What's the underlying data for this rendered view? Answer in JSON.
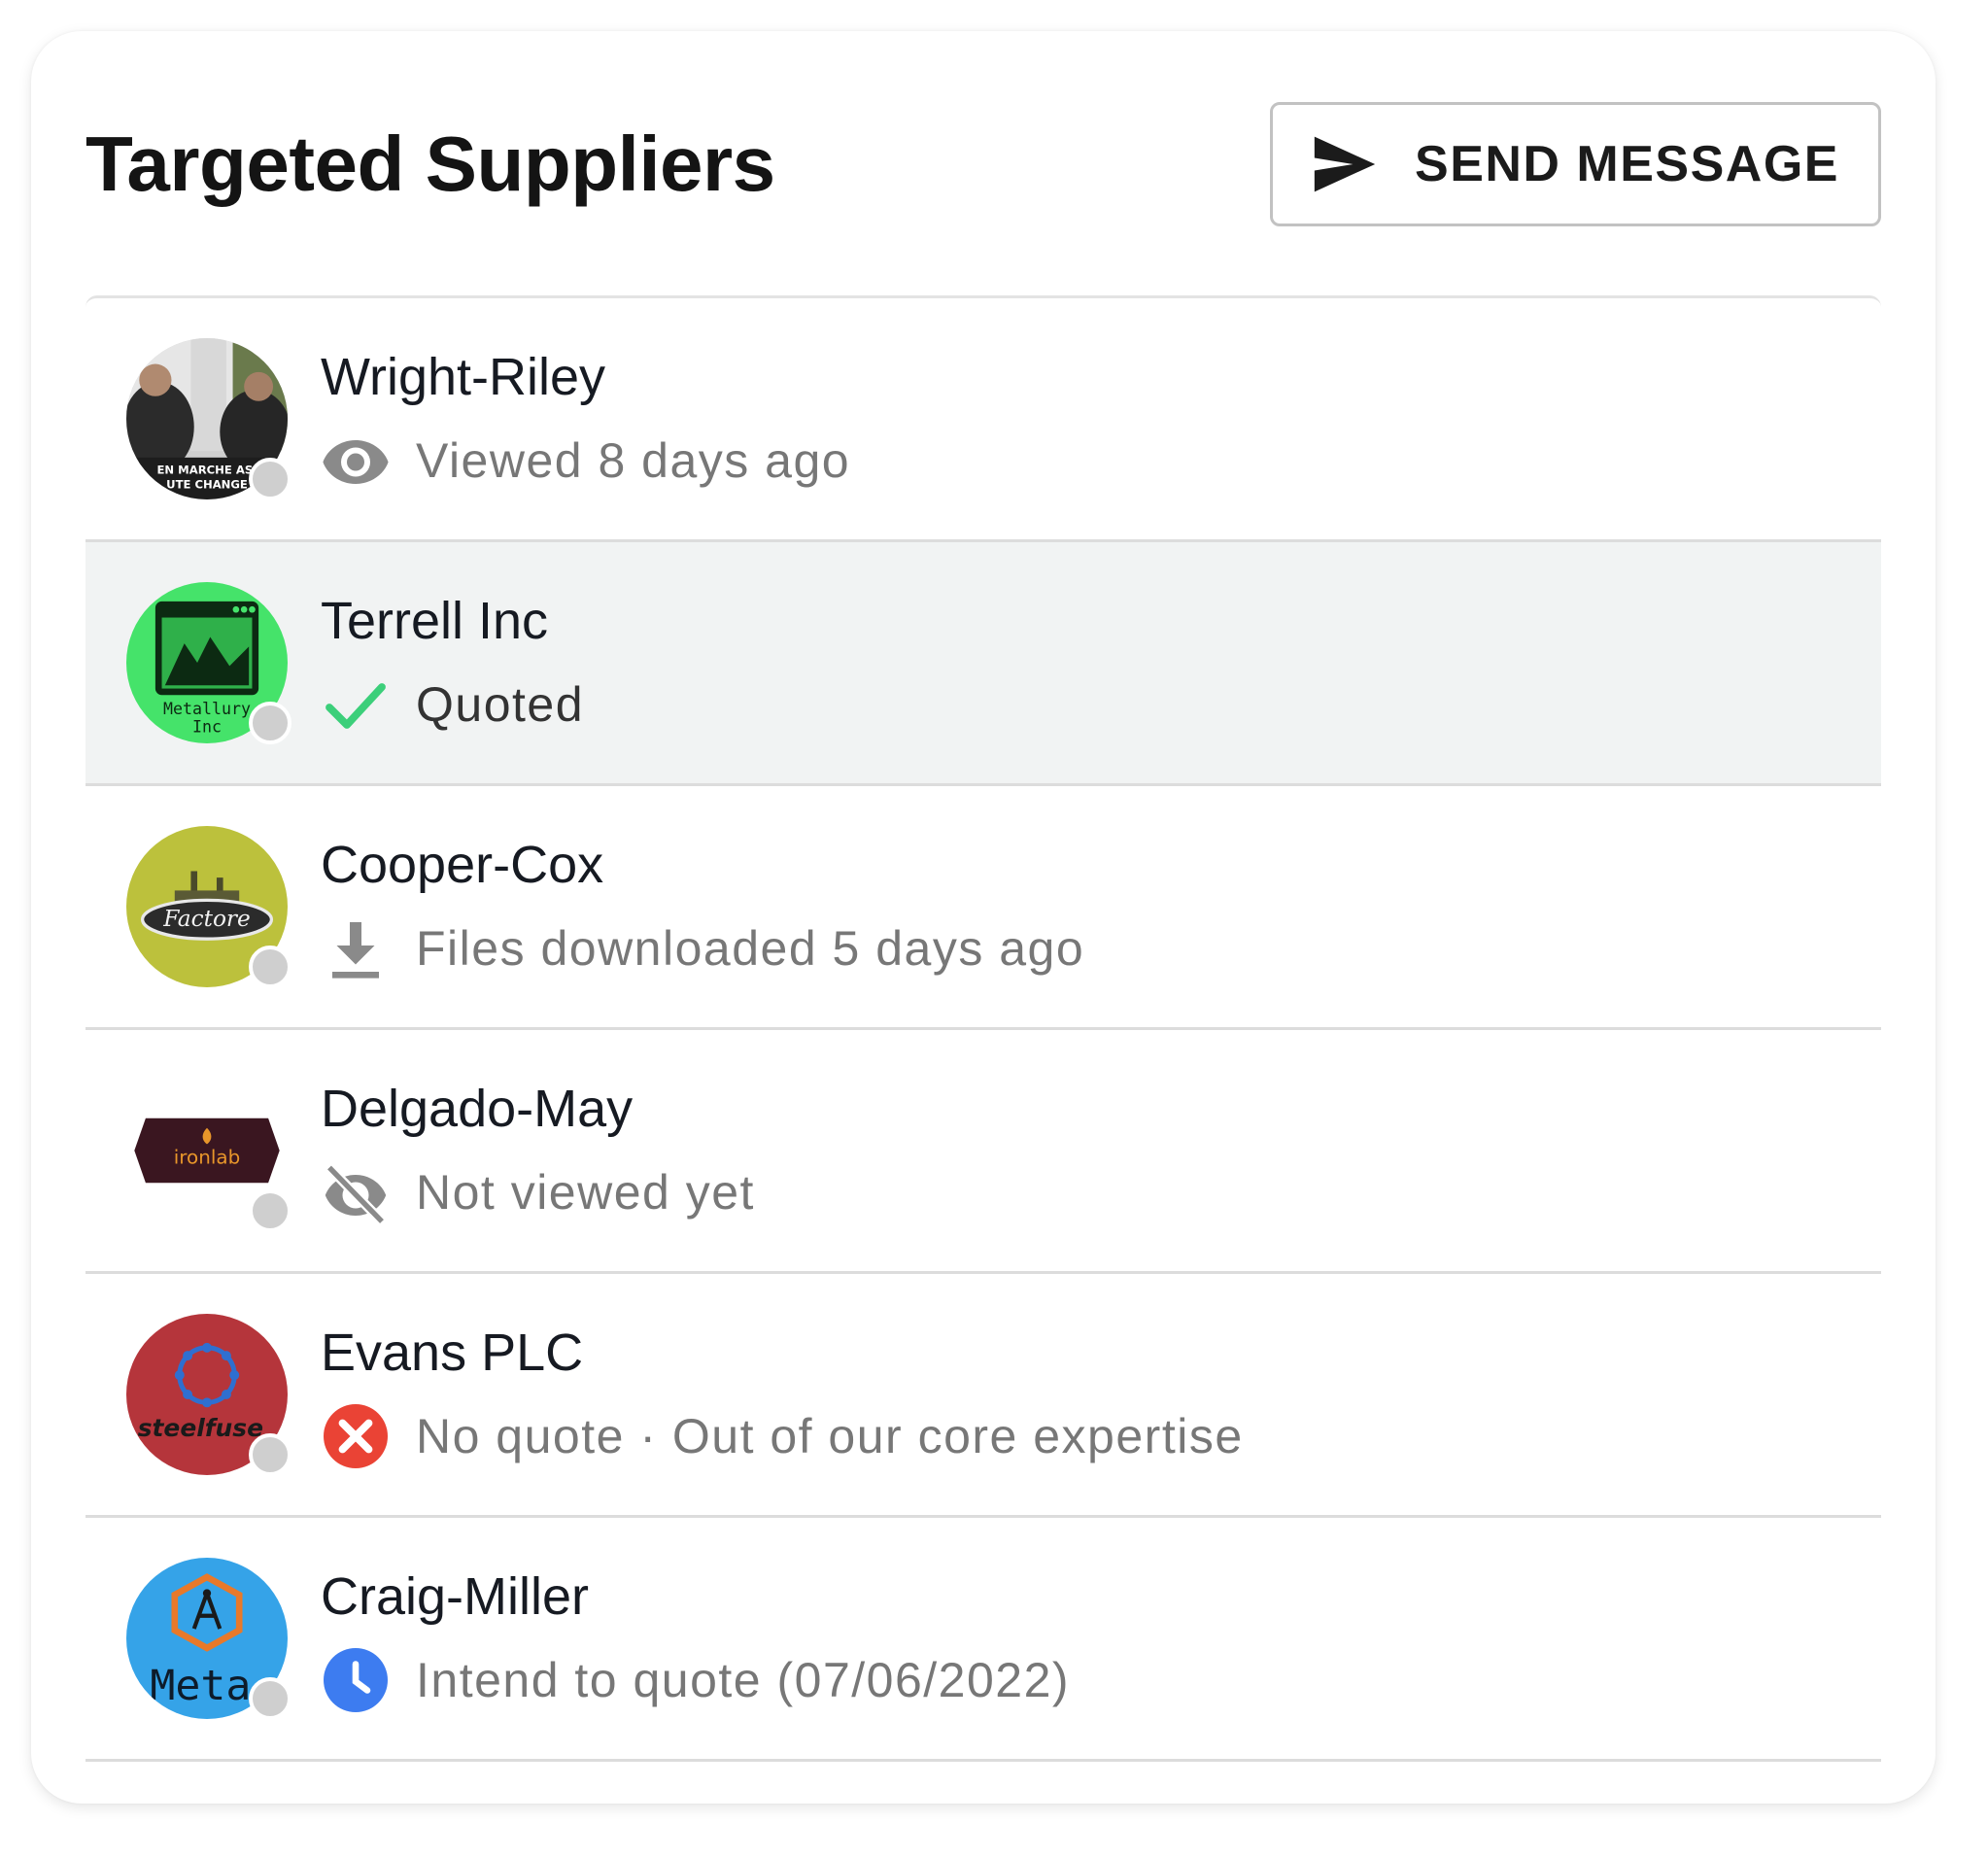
{
  "header": {
    "title": "Targeted Suppliers",
    "send_button_label": "SEND MESSAGE"
  },
  "colors": {
    "quoted_check": "#3ccf7a",
    "no_quote_badge": "#ea4335",
    "intend_clock": "#3d7cf0",
    "muted_icon": "#8a8a8a",
    "presence_dot": "#cfcfcf",
    "selected_row_bg": "#f1f3f3"
  },
  "suppliers": [
    {
      "name": "Wright-Riley",
      "status_icon": "eye-icon",
      "status_text": "Viewed 8 days ago",
      "logo_text": "EN MARCHE ASI | UTE CHANGE",
      "selected": false
    },
    {
      "name": "Terrell Inc",
      "status_icon": "check-icon",
      "status_text": "Quoted",
      "logo_text": "Metallury Inc",
      "selected": true
    },
    {
      "name": "Cooper-Cox",
      "status_icon": "download-icon",
      "status_text": "Files downloaded 5 days ago",
      "logo_text": "Factore",
      "selected": false
    },
    {
      "name": "Delgado-May",
      "status_icon": "eye-off-icon",
      "status_text": "Not viewed yet",
      "logo_text": "ironlab",
      "selected": false
    },
    {
      "name": "Evans PLC",
      "status_icon": "cancel-icon",
      "status_text": "No quote · Out of our core expertise",
      "logo_text": "steelfuse",
      "selected": false
    },
    {
      "name": "Craig-Miller",
      "status_icon": "clock-icon",
      "status_text": "Intend to quote (07/06/2022)",
      "logo_text": "Meta",
      "selected": false
    }
  ]
}
